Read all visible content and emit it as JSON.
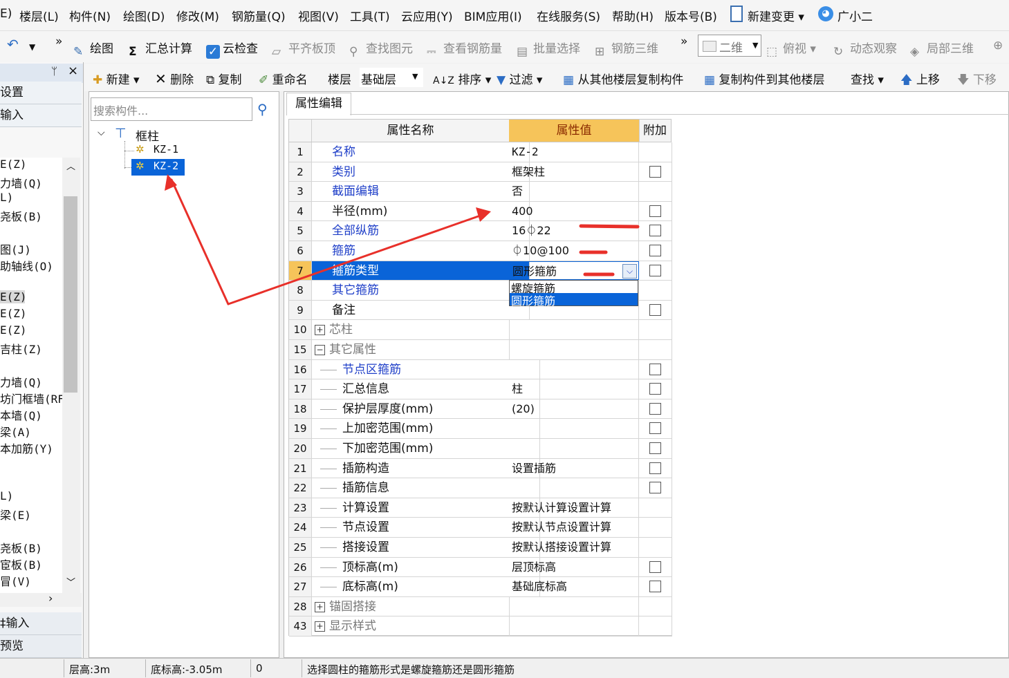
{
  "menu": {
    "items": [
      "E)",
      "楼层(L)",
      "构件(N)",
      "绘图(D)",
      "修改(M)",
      "钢筋量(Q)",
      "视图(V)",
      "工具(T)",
      "云应用(Y)",
      "BIM应用(I)",
      "在线服务(S)",
      "帮助(H)",
      "版本号(B)",
      "新建变更",
      "广小二"
    ]
  },
  "toolbar1": {
    "more": "»",
    "draw": "绘图",
    "sum": "汇总计算",
    "cloud_check": "云检查",
    "flat_top": "平齐板顶",
    "find_element": "查找图元",
    "view_rebar": "查看钢筋量",
    "batch_select": "批量选择",
    "rebar_3d": "钢筋三维",
    "view_mode": "二维",
    "top_view": "俯视",
    "dynamic_view": "动态观察",
    "local_3d": "局部三维"
  },
  "toolbar2": {
    "new": "新建",
    "delete": "删除",
    "copy": "复制",
    "rename": "重命名",
    "floor_label": "楼层",
    "floor_value": "基础层",
    "sort": "排序",
    "filter": "过滤",
    "copy_from_floor": "从其他楼层复制构件",
    "copy_to_floor": "复制构件到其他楼层",
    "find": "查找",
    "move_up": "上移",
    "move_down": "下移"
  },
  "leftpanel": {
    "pin": "ᛘ",
    "close": "×",
    "top_items": [
      "设置",
      "输入"
    ],
    "items": [
      "E(Z)",
      "力墙(Q)",
      "L)",
      "尧板(B)",
      "",
      "图(J)",
      "助轴线(O)",
      "",
      "E(Z)",
      "E(Z)",
      "E(Z)",
      "吉柱(Z)",
      "",
      "力墙(Q)",
      "坊门框墙(RF",
      "本墙(Q)",
      "梁(A)",
      "本加筋(Y)",
      "",
      "",
      "L)",
      "梁(E)",
      "",
      "尧板(B)",
      "宦板(B)",
      "冒(V)"
    ],
    "bottom_items": [
      "‡输入",
      "预览"
    ]
  },
  "tree": {
    "search_placeholder": "搜索构件...",
    "root": "框柱",
    "children": [
      "KZ-1",
      "KZ-2"
    ]
  },
  "prop": {
    "tab": "属性编辑",
    "headers": {
      "name": "属性名称",
      "value": "属性值",
      "extra": "附加"
    },
    "rows": [
      {
        "num": "1",
        "name": "名称",
        "value": "KZ-2"
      },
      {
        "num": "2",
        "name": "类别",
        "value": "框架柱"
      },
      {
        "num": "3",
        "name": "截面编辑",
        "value": "否"
      },
      {
        "num": "4",
        "name": "半径(mm)",
        "value": "400"
      },
      {
        "num": "5",
        "name": "全部纵筋",
        "value": "16⏀22"
      },
      {
        "num": "6",
        "name": "箍筋",
        "value": "⏀10@100"
      },
      {
        "num": "7",
        "name": "箍筋类型",
        "value": "圆形箍筋"
      },
      {
        "num": "8",
        "name": "其它箍筋",
        "value": ""
      },
      {
        "num": "9",
        "name": "备注",
        "value": ""
      },
      {
        "num": "10",
        "name": "芯柱",
        "value": ""
      },
      {
        "num": "15",
        "name": "其它属性",
        "value": ""
      },
      {
        "num": "16",
        "name": "节点区箍筋",
        "value": ""
      },
      {
        "num": "17",
        "name": "汇总信息",
        "value": "柱"
      },
      {
        "num": "18",
        "name": "保护层厚度(mm)",
        "value": "(20)"
      },
      {
        "num": "19",
        "name": "上加密范围(mm)",
        "value": ""
      },
      {
        "num": "20",
        "name": "下加密范围(mm)",
        "value": ""
      },
      {
        "num": "21",
        "name": "插筋构造",
        "value": "设置插筋"
      },
      {
        "num": "22",
        "name": "插筋信息",
        "value": ""
      },
      {
        "num": "23",
        "name": "计算设置",
        "value": "按默认计算设置计算"
      },
      {
        "num": "24",
        "name": "节点设置",
        "value": "按默认节点设置计算"
      },
      {
        "num": "25",
        "name": "搭接设置",
        "value": "按默认搭接设置计算"
      },
      {
        "num": "26",
        "name": "顶标高(m)",
        "value": "层顶标高"
      },
      {
        "num": "27",
        "name": "底标高(m)",
        "value": "基础底标高"
      },
      {
        "num": "28",
        "name": "锚固搭接",
        "value": ""
      },
      {
        "num": "43",
        "name": "显示样式",
        "value": ""
      }
    ],
    "dropdown_options": [
      "螺旋箍筋",
      "圆形箍筋"
    ]
  },
  "status": {
    "floor_height": "层高:3m",
    "bottom_elev": "底标高:-3.05m",
    "zero": "0",
    "hint": "选择圆柱的箍筋形式是螺旋箍筋还是圆形箍筋"
  },
  "colors": {
    "accent_blue": "#1f3fc8",
    "selection": "#0a64d8",
    "header_orange": "#f6c45a",
    "annotation_red": "#e8302a"
  }
}
